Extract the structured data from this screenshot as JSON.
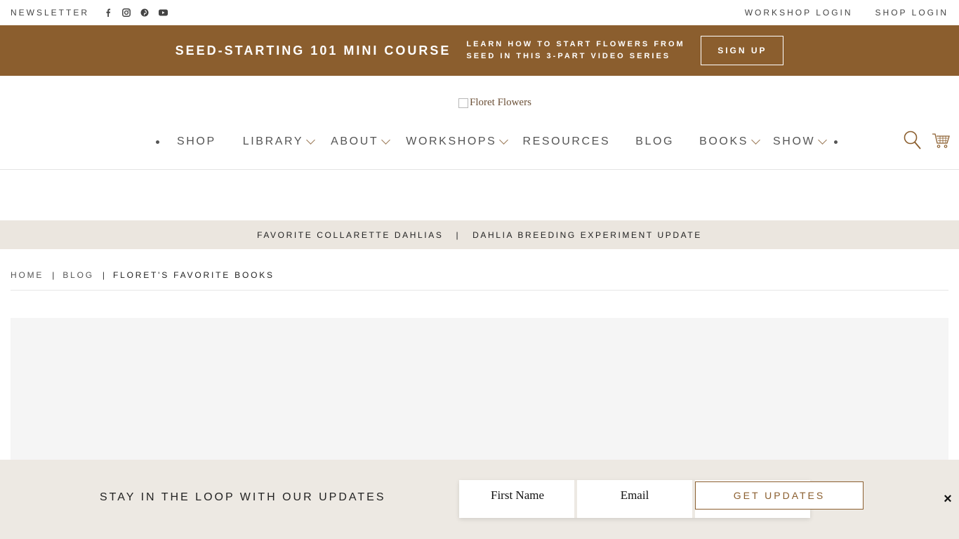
{
  "utility": {
    "newsletter": "NEWSLETTER",
    "socials": [
      "facebook-icon",
      "instagram-icon",
      "pinterest-icon",
      "youtube-icon"
    ],
    "workshop_login": "WORKSHOP LOGIN",
    "shop_login": "SHOP LOGIN"
  },
  "promo": {
    "title": "SEED-STARTING 101 MINI COURSE",
    "desc_line1": "LEARN HOW TO START FLOWERS FROM",
    "desc_line2": "SEED IN THIS 3-PART VIDEO SERIES",
    "button": "SIGN UP",
    "bg_color": "#8b5e2e"
  },
  "header": {
    "logo_alt": "Floret Flowers",
    "nav": [
      {
        "label": "SHOP",
        "dropdown": false
      },
      {
        "label": "LIBRARY",
        "dropdown": true
      },
      {
        "label": "ABOUT",
        "dropdown": true
      },
      {
        "label": "WORKSHOPS",
        "dropdown": true
      },
      {
        "label": "RESOURCES",
        "dropdown": false
      },
      {
        "label": "BLOG",
        "dropdown": false
      },
      {
        "label": "BOOKS",
        "dropdown": true
      },
      {
        "label": "SHOW",
        "dropdown": true
      }
    ],
    "icons": [
      "search-icon",
      "cart-icon"
    ]
  },
  "related": {
    "left": "FAVORITE COLLARETTE DAHLIAS",
    "separator": "|",
    "right": "DAHLIA BREEDING EXPERIMENT UPDATE"
  },
  "breadcrumb": {
    "home": "HOME",
    "blog": "BLOG",
    "current": "FLORET'S FAVORITE BOOKS",
    "separator": "|"
  },
  "signup": {
    "text": "STAY IN THE LOOP WITH OUR UPDATES",
    "first_name": "First Name",
    "email": "Email",
    "button": "GET UPDATES",
    "close": "×"
  }
}
